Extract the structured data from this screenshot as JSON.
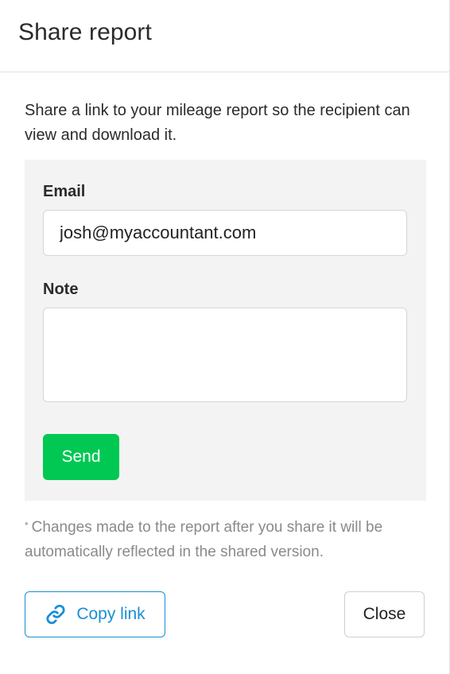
{
  "dialog": {
    "title": "Share report",
    "description": "Share a link to your mileage report so the recipient can view and download it."
  },
  "form": {
    "email_label": "Email",
    "email_value": "josh@myaccountant.com",
    "note_label": "Note",
    "note_value": "",
    "send_label": "Send"
  },
  "footnote": {
    "asterisk": "*",
    "text": "Changes made to the report after you share it will be automatically reflected in the shared version."
  },
  "actions": {
    "copy_link_label": "Copy link",
    "copy_link_icon": "link-icon",
    "close_label": "Close"
  },
  "colors": {
    "accent_blue": "#1a8fd6",
    "send_green": "#00c853",
    "panel_bg": "#f3f3f3",
    "muted_text": "#8a8a8a"
  }
}
